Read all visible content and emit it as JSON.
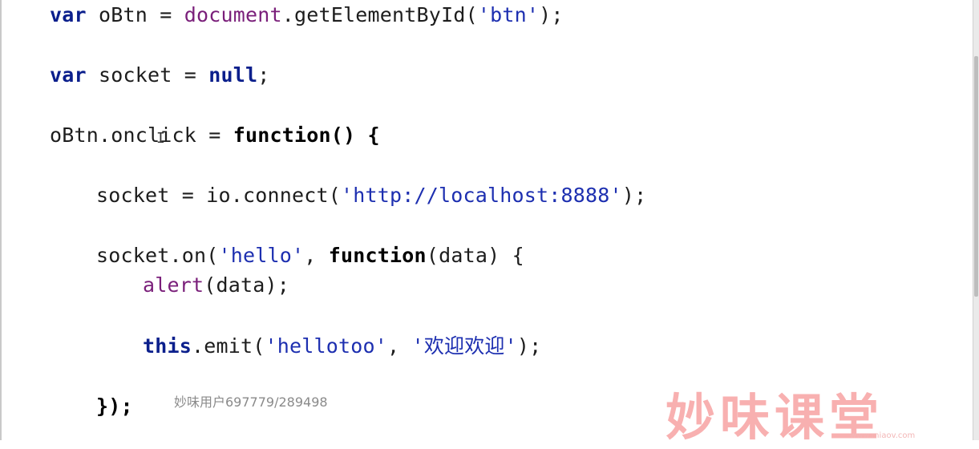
{
  "code": {
    "line1": {
      "kw_var": "var",
      "text1": " oBtn = ",
      "builtin": "document",
      "text2": ".getElementById(",
      "str": "'btn'",
      "text3": ");"
    },
    "line2": {
      "kw_var": "var",
      "text1": " socket = ",
      "kw_null": "null",
      "text2": ";"
    },
    "line3": {
      "text1": "oBtn.onclick = ",
      "kw_function": "function",
      "text2": "() {"
    },
    "line4": {
      "text1": "socket = io.connect(",
      "str": "'http://localhost:8888'",
      "text2": ");"
    },
    "line5": {
      "text1": "socket.on(",
      "str": "'hello'",
      "text2": ", ",
      "kw_function": "function",
      "text3": "(data) {"
    },
    "line6": {
      "builtin": "alert",
      "text1": "(data);"
    },
    "line7": {
      "kw_this": "this",
      "text1": ".emit(",
      "str1": "'hellotoo'",
      "text2": ", ",
      "str2": "'欢迎欢迎'",
      "text3": ");"
    },
    "line8": {
      "text1": "});"
    }
  },
  "cursor": {
    "glyph": "I"
  },
  "watermark": {
    "user": "妙味用户697779/289498",
    "brand": "妙味课堂",
    "url": "www.miaov.com"
  }
}
